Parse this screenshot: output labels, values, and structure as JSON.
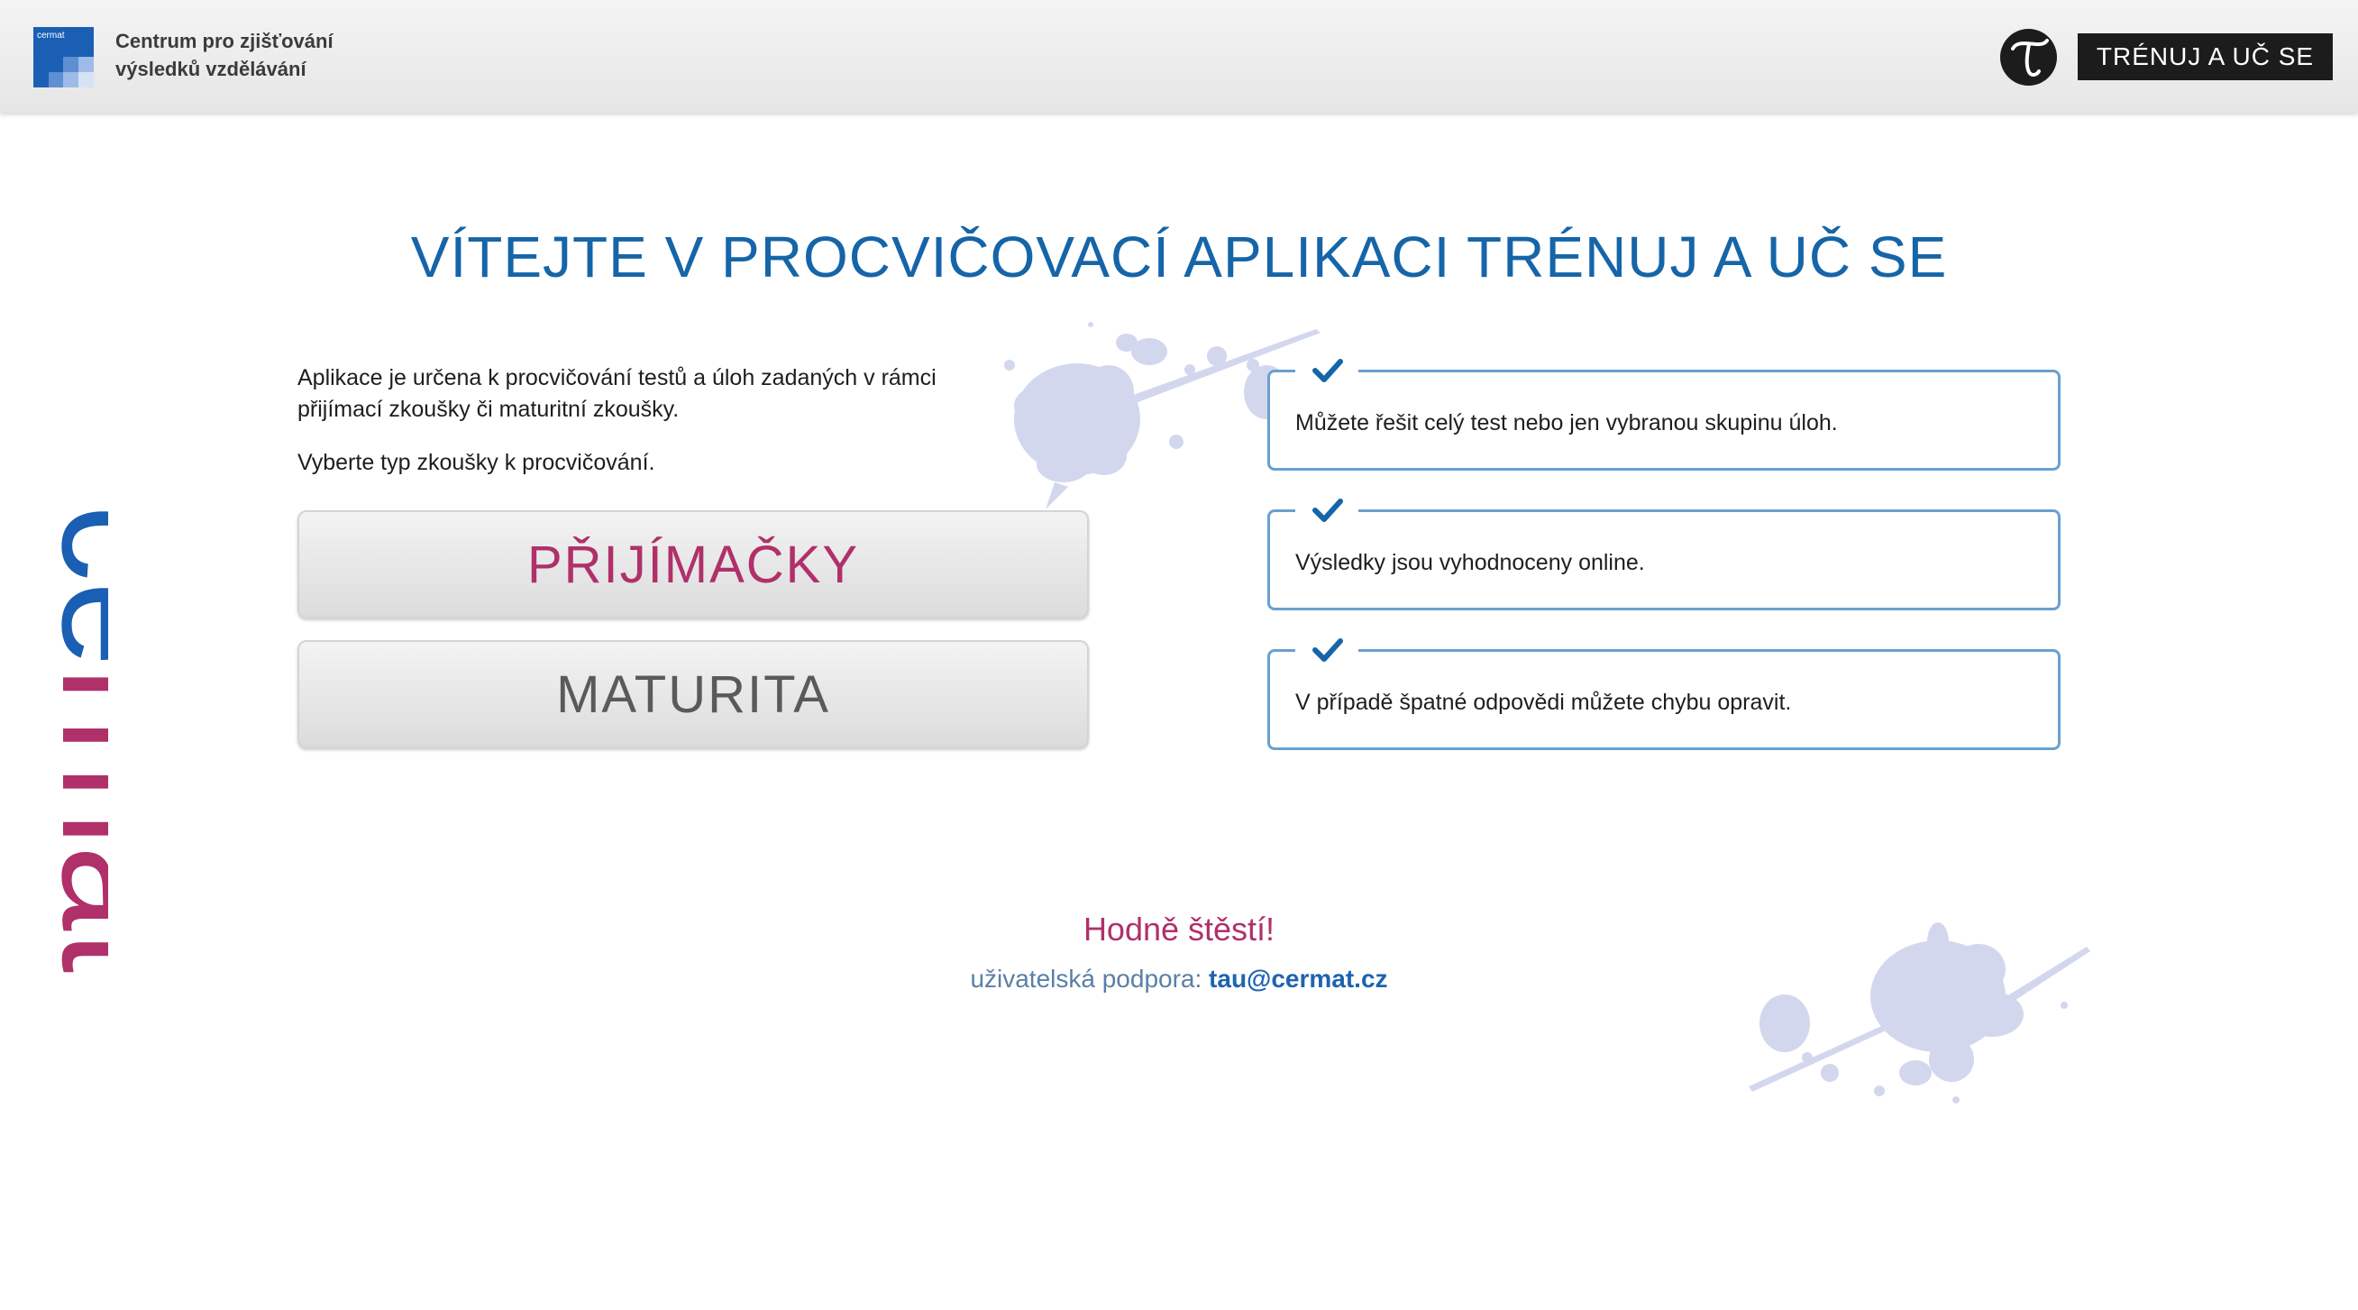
{
  "header": {
    "logo_label": "cermat",
    "org_line1": "Centrum pro zjišťování",
    "org_line2": "výsledků vzdělávání",
    "brand_button": "TRÉNUJ A UČ SE"
  },
  "title": "VÍTEJTE V PROCVIČOVACÍ APLIKACI TRÉNUJ A UČ SE",
  "intro": {
    "text": "Aplikace je určena k procvičování testů a úloh zadaných v rámci přijímací zkoušky či maturitní zkoušky.",
    "choose": "Vyberte typ zkoušky k procvičování."
  },
  "exams": {
    "prijimacky": "PŘIJÍMAČKY",
    "maturita": "MATURITA"
  },
  "features": [
    "Můžete řešit celý test nebo jen vybranou skupinu úloh.",
    "Výsledky jsou vyhodnoceny online.",
    "V případě špatné odpovědi můžete chybu opravit."
  ],
  "footer": {
    "good_luck": "Hodně štěstí!",
    "support_label": "uživatelská podpora:",
    "support_email": "tau@cermat.cz"
  },
  "side_wordmark": "cermat",
  "colors": {
    "title_blue": "#1565a8",
    "accent_magenta": "#b0306a",
    "card_border": "#6aa0cf",
    "splat": "#d3d7ee"
  }
}
